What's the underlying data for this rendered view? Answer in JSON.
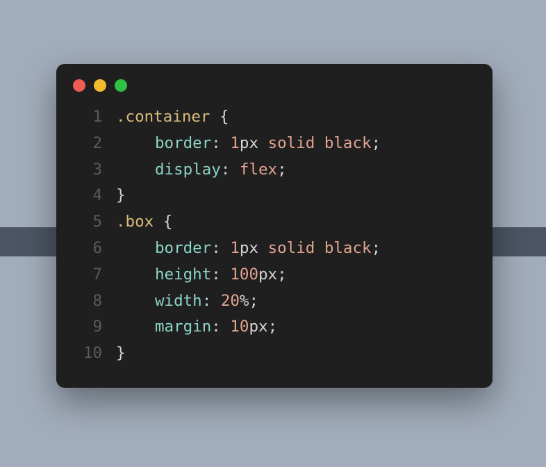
{
  "traffic_lights": {
    "red": "#ee5c53",
    "yellow": "#f2bb2f",
    "green": "#2fc146"
  },
  "syntax_colors": {
    "selector": "#d8b97a",
    "punct": "#d4d4d4",
    "property": "#8cd4c6",
    "number": "#e2a38f",
    "value": "#e2a38f",
    "line_number": "#5a5a5a",
    "background": "#1f1f1f"
  },
  "code": {
    "lines": [
      {
        "n": "1",
        "indent": 0,
        "tokens": [
          {
            "t": ".container",
            "c": "selector"
          },
          {
            "t": " ",
            "c": "plain"
          },
          {
            "t": "{",
            "c": "punct"
          }
        ]
      },
      {
        "n": "2",
        "indent": 1,
        "tokens": [
          {
            "t": "border",
            "c": "prop"
          },
          {
            "t": ": ",
            "c": "punct"
          },
          {
            "t": "1",
            "c": "num"
          },
          {
            "t": "px",
            "c": "unit"
          },
          {
            "t": " ",
            "c": "plain"
          },
          {
            "t": "solid",
            "c": "value"
          },
          {
            "t": " ",
            "c": "plain"
          },
          {
            "t": "black",
            "c": "value"
          },
          {
            "t": ";",
            "c": "punct"
          }
        ]
      },
      {
        "n": "3",
        "indent": 1,
        "tokens": [
          {
            "t": "display",
            "c": "prop"
          },
          {
            "t": ": ",
            "c": "punct"
          },
          {
            "t": "flex",
            "c": "value"
          },
          {
            "t": ";",
            "c": "punct"
          }
        ]
      },
      {
        "n": "4",
        "indent": 0,
        "tokens": [
          {
            "t": "}",
            "c": "punct"
          }
        ]
      },
      {
        "n": "5",
        "indent": 0,
        "tokens": [
          {
            "t": ".box",
            "c": "selector"
          },
          {
            "t": " ",
            "c": "plain"
          },
          {
            "t": "{",
            "c": "punct"
          }
        ]
      },
      {
        "n": "6",
        "indent": 1,
        "tokens": [
          {
            "t": "border",
            "c": "prop"
          },
          {
            "t": ": ",
            "c": "punct"
          },
          {
            "t": "1",
            "c": "num"
          },
          {
            "t": "px",
            "c": "unit"
          },
          {
            "t": " ",
            "c": "plain"
          },
          {
            "t": "solid",
            "c": "value"
          },
          {
            "t": " ",
            "c": "plain"
          },
          {
            "t": "black",
            "c": "value"
          },
          {
            "t": ";",
            "c": "punct"
          }
        ]
      },
      {
        "n": "7",
        "indent": 1,
        "tokens": [
          {
            "t": "height",
            "c": "prop"
          },
          {
            "t": ": ",
            "c": "punct"
          },
          {
            "t": "100",
            "c": "num"
          },
          {
            "t": "px",
            "c": "unit"
          },
          {
            "t": ";",
            "c": "punct"
          }
        ]
      },
      {
        "n": "8",
        "indent": 1,
        "tokens": [
          {
            "t": "width",
            "c": "prop"
          },
          {
            "t": ": ",
            "c": "punct"
          },
          {
            "t": "20",
            "c": "num"
          },
          {
            "t": "%",
            "c": "unit"
          },
          {
            "t": ";",
            "c": "punct"
          }
        ]
      },
      {
        "n": "9",
        "indent": 1,
        "tokens": [
          {
            "t": "margin",
            "c": "prop"
          },
          {
            "t": ": ",
            "c": "punct"
          },
          {
            "t": "10",
            "c": "num"
          },
          {
            "t": "px",
            "c": "unit"
          },
          {
            "t": ";",
            "c": "punct"
          }
        ]
      },
      {
        "n": "10",
        "indent": 0,
        "tokens": [
          {
            "t": "}",
            "c": "punct"
          }
        ]
      }
    ]
  }
}
